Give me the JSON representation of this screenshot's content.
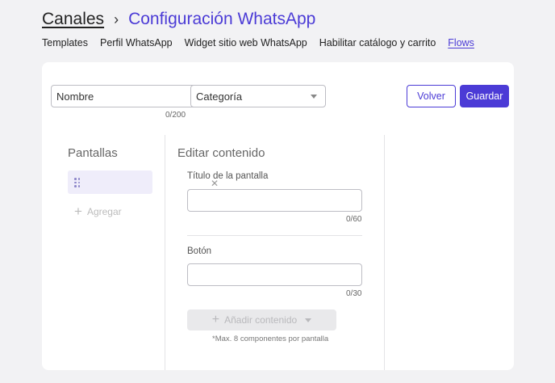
{
  "breadcrumb": {
    "root": "Canales",
    "separator": "›",
    "current": "Configuración WhatsApp"
  },
  "subnav": {
    "items": [
      "Templates",
      "Perfil WhatsApp",
      "Widget sitio web WhatsApp",
      "Habilitar catálogo y carrito",
      "Flows"
    ],
    "active_index": 4
  },
  "form": {
    "name": {
      "placeholder": "Nombre",
      "value": "",
      "counter": "0/200"
    },
    "category": {
      "selected": "Categoría"
    },
    "back_label": "Volver",
    "save_label": "Guardar"
  },
  "screens": {
    "title": "Pantallas",
    "add_label": "Agregar"
  },
  "editor": {
    "title": "Editar contenido",
    "screen_title_label": "Título de la pantalla",
    "screen_title_value": "",
    "screen_title_counter": "0/60",
    "button_label": "Botón",
    "button_value": "",
    "button_counter": "0/30",
    "add_content_label": "Añadir contenido",
    "note": "*Max. 8 componentes por pantalla"
  },
  "colors": {
    "accent": "#4b3bd6",
    "selected_row": "#efedfa"
  }
}
